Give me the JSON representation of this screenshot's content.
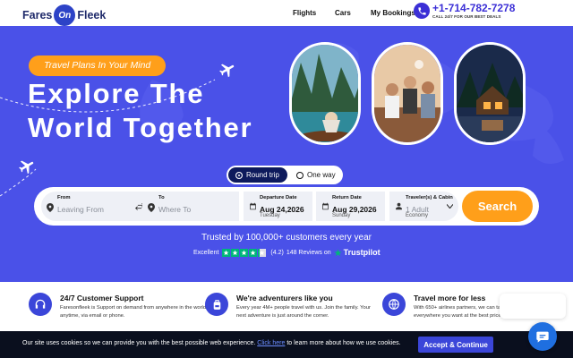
{
  "header": {
    "logo_left": "Fares",
    "logo_mid": "On",
    "logo_right": "Fleek",
    "nav": [
      "Flights",
      "Cars",
      "My Bookings"
    ],
    "phone": "+1-714-782-7278",
    "phone_sub": "CALL 24/7 FOR OUR BEST DEALS"
  },
  "hero": {
    "tagline": "Travel Plans In Your Mind",
    "headline_line1": "Explore The",
    "headline_line2": "World Together"
  },
  "trip_type": {
    "options": [
      "Round trip",
      "One way"
    ],
    "selected": "Round trip"
  },
  "search": {
    "from_label": "From",
    "from_placeholder": "Leaving From",
    "to_label": "To",
    "to_placeholder": "Where To",
    "departure_label": "Departure Date",
    "departure_date": "Aug 24,2026",
    "departure_day": "Tuesday",
    "return_label": "Return Date",
    "return_date": "Aug 29,2026",
    "return_day": "Sunday",
    "travelers_label": "Traveler(s) & Cabin",
    "travelers_value": "1 Adult",
    "cabin_value": "Economy",
    "button": "Search"
  },
  "trust": {
    "headline": "Trusted by 100,000+ customers every year",
    "rating_word": "Excellent",
    "rating": "(4.2)",
    "reviews": "148 Reviews on",
    "brand": "Trustpilot",
    "stars_value": 4.2
  },
  "features": [
    {
      "title": "24/7 Customer Support",
      "desc": "Faresonfleek is Support on demand from anywhere in the world, anytime, via email or phone.",
      "icon": "headset-icon"
    },
    {
      "title": "We're adventurers like you",
      "desc": "Every year 4M+ people travel with us. Join the family. Your next adventure is just around the corner.",
      "icon": "backpack-icon"
    },
    {
      "title": "Travel more for less",
      "desc": "With 650+ airlines partners, we can take you everywhere you want at the best price.",
      "icon": "globe-icon"
    }
  ],
  "cookie": {
    "text_before": "Our site uses cookies so we can provide you with the best possible web experience.",
    "link": "Click here",
    "text_after": "to learn more about how we use cookies.",
    "button": "Accept & Continue"
  },
  "colors": {
    "hero_bg": "#4a51e8",
    "accent_orange": "#ff9f1a",
    "brand_blue": "#3b46d9",
    "navy": "#0d1a5c",
    "trustpilot_green": "#00b67a"
  }
}
